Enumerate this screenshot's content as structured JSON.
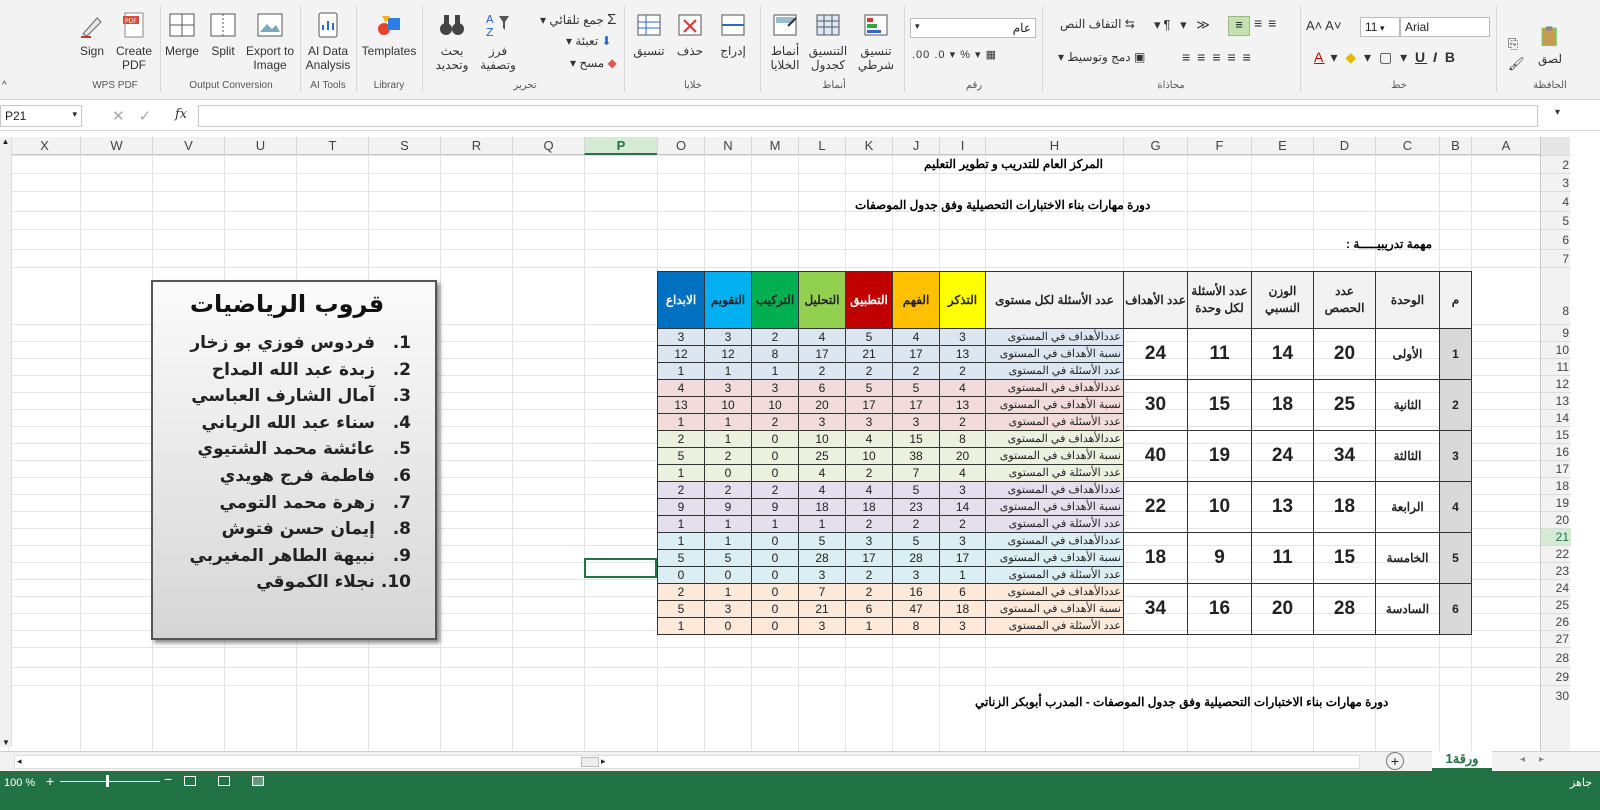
{
  "ribbon": {
    "wps": {
      "sign": "Sign",
      "create_pdf": "Create\nPDF",
      "group": "WPS PDF"
    },
    "output": {
      "merge": "Merge",
      "split": "Split",
      "export": "Export to\nImage",
      "group": "Output Conversion"
    },
    "ai": {
      "data": "AI Data\nAnalysis",
      "group": "AI Tools"
    },
    "library": {
      "templates": "Templates",
      "group": "Library"
    },
    "edit": {
      "find": "بحث\nوتحديد",
      "sort": "فرز\nوتصفية",
      "autosum": "جمع تلقائي",
      "fill": "تعبئة",
      "clear": "مسح",
      "group": "تحرير"
    },
    "cells": {
      "format": "تنسيق",
      "delete": "حذف",
      "insert": "إدراج",
      "group": "خلايا"
    },
    "styles": {
      "cell_styles": "أنماط\nالخلايا",
      "format_table": "التنسيق\nكجدول",
      "conditional": "تنسيق\nشرطي",
      "group": "أنماط"
    },
    "number": {
      "format_value": "عام",
      "group": "رقم"
    },
    "align": {
      "wrap": "التفاف النص",
      "merge": "دمج وتوسيط",
      "group": "محاذاة"
    },
    "font": {
      "name": "Arial",
      "size": "11",
      "group": "خط"
    },
    "clipboard": {
      "paste": "لصق",
      "group": "الحافظة"
    }
  },
  "formula_bar": {
    "name_box": "P21",
    "fx": "fx"
  },
  "columns": [
    "X",
    "W",
    "V",
    "U",
    "T",
    "S",
    "R",
    "Q",
    "P",
    "O",
    "N",
    "M",
    "L",
    "K",
    "J",
    "I",
    "H",
    "G",
    "F",
    "E",
    "D",
    "C",
    "B",
    "A"
  ],
  "selected_column": "P",
  "rows": [
    "2",
    "3",
    "4",
    "5",
    "6",
    "7",
    "8",
    "9",
    "10",
    "11",
    "12",
    "13",
    "14",
    "15",
    "16",
    "17",
    "18",
    "19",
    "20",
    "21",
    "22",
    "23",
    "24",
    "25",
    "26",
    "27",
    "28",
    "29",
    "30"
  ],
  "selected_row": "21",
  "sheet": {
    "line1": "المركز العام للتدريب و تطوير التعليم",
    "line2": "دورة مهارات بناء الاختبارات التحصيلية وفق جدول الموصفات",
    "task": "مهمة تدريبيـــــة  :",
    "footer": "دورة مهارات بناء الاختبارات التحصيلية وفق جدول الموصفات - المدرب أبوبكر الزناتي"
  },
  "table": {
    "headers": [
      "م",
      "الوحدة",
      "عدد الحصص",
      "الوزن النسبي",
      "عدد الأسئلة لكل وحدة",
      "عدد الأهداف",
      "عدد الأسئلة لكل مستوى",
      "التذكر",
      "الفهم",
      "التطبيق",
      "التحليل",
      "التركيب",
      "التقويم",
      "الابداع"
    ],
    "header_colors": [
      "#ffff00",
      "#ffc000",
      "#c00000",
      "#92d050",
      "#00b050",
      "#00b0f0",
      "#0070c0"
    ],
    "row_labels": [
      "عددالأهداف في المستوى",
      "نسبة الأهداف في المستوى",
      "عدد الأسئلة في المستوى"
    ],
    "units": [
      {
        "num": "1",
        "name": "الأولى",
        "classes": "20",
        "weight": "14",
        "questions": "11",
        "goals": "24",
        "bg": "#dce6f1",
        "rows": [
          [
            "3",
            "4",
            "5",
            "4",
            "2",
            "3",
            "3"
          ],
          [
            "13",
            "17",
            "21",
            "17",
            "8",
            "12",
            "12"
          ],
          [
            "2",
            "2",
            "2",
            "2",
            "1",
            "1",
            "1"
          ]
        ]
      },
      {
        "num": "2",
        "name": "الثانية",
        "classes": "25",
        "weight": "18",
        "questions": "15",
        "goals": "30",
        "bg": "#f2dcdb",
        "rows": [
          [
            "4",
            "5",
            "5",
            "6",
            "3",
            "3",
            "4"
          ],
          [
            "13",
            "17",
            "17",
            "20",
            "10",
            "10",
            "13"
          ],
          [
            "2",
            "3",
            "3",
            "3",
            "2",
            "1",
            "1"
          ]
        ]
      },
      {
        "num": "3",
        "name": "الثالثة",
        "classes": "34",
        "weight": "24",
        "questions": "19",
        "goals": "40",
        "bg": "#ebf1de",
        "rows": [
          [
            "8",
            "15",
            "4",
            "10",
            "0",
            "1",
            "2"
          ],
          [
            "20",
            "38",
            "10",
            "25",
            "0",
            "2",
            "5"
          ],
          [
            "4",
            "7",
            "2",
            "4",
            "0",
            "0",
            "1"
          ]
        ]
      },
      {
        "num": "4",
        "name": "الرابعة",
        "classes": "18",
        "weight": "13",
        "questions": "10",
        "goals": "22",
        "bg": "#e4dfec",
        "rows": [
          [
            "3",
            "5",
            "4",
            "4",
            "2",
            "2",
            "2"
          ],
          [
            "14",
            "23",
            "18",
            "18",
            "9",
            "9",
            "9"
          ],
          [
            "2",
            "2",
            "2",
            "1",
            "1",
            "1",
            "1"
          ]
        ]
      },
      {
        "num": "5",
        "name": "الخامسة",
        "classes": "15",
        "weight": "11",
        "questions": "9",
        "goals": "18",
        "bg": "#daeef3",
        "rows": [
          [
            "3",
            "5",
            "3",
            "5",
            "0",
            "1",
            "1"
          ],
          [
            "17",
            "28",
            "17",
            "28",
            "0",
            "5",
            "5"
          ],
          [
            "1",
            "3",
            "2",
            "3",
            "0",
            "0",
            "0"
          ]
        ]
      },
      {
        "num": "6",
        "name": "السادسة",
        "classes": "28",
        "weight": "20",
        "questions": "16",
        "goals": "34",
        "bg": "#fde9d9",
        "rows": [
          [
            "6",
            "16",
            "2",
            "7",
            "0",
            "1",
            "2"
          ],
          [
            "18",
            "47",
            "6",
            "21",
            "0",
            "3",
            "5"
          ],
          [
            "3",
            "8",
            "1",
            "3",
            "0",
            "0",
            "1"
          ]
        ]
      }
    ]
  },
  "card": {
    "title": "قروب الرياضيات",
    "members": [
      {
        "n": "1.",
        "name": "فردوس فوزي بو زخار"
      },
      {
        "n": "2.",
        "name": "زبدة عبد الله المداح"
      },
      {
        "n": "3.",
        "name": "آمال الشارف العباسي"
      },
      {
        "n": "4.",
        "name": "سناء عبد الله الرياني"
      },
      {
        "n": "5.",
        "name": "عائشة محمد الشتيوي"
      },
      {
        "n": "6.",
        "name": "فاطمة فرج هويدي"
      },
      {
        "n": "7.",
        "name": "زهرة محمد التومي"
      },
      {
        "n": "8.",
        "name": "إيمان حسن فتوش"
      },
      {
        "n": "9.",
        "name": "نبيهة الطاهر المغيربي"
      },
      {
        "n": "10.",
        "name": "نجلاء الكموقي"
      }
    ]
  },
  "sheet_tab": "ورقة1",
  "status": {
    "ready": "جاهز",
    "zoom": "100 %"
  }
}
